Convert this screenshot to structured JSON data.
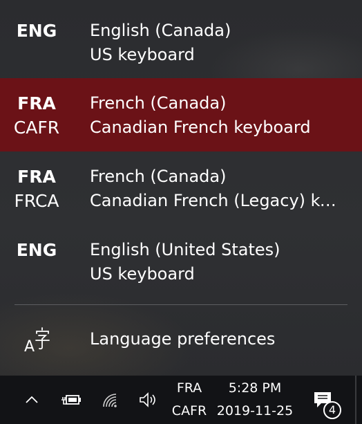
{
  "language_flyout": {
    "items": [
      {
        "code": "ENG",
        "sub_code": "",
        "language": "English (Canada)",
        "keyboard": "US keyboard",
        "selected": false
      },
      {
        "code": "FRA",
        "sub_code": "CAFR",
        "language": "French (Canada)",
        "keyboard": "Canadian French keyboard",
        "selected": true
      },
      {
        "code": "FRA",
        "sub_code": "FRCA",
        "language": "French (Canada)",
        "keyboard": "Canadian French (Legacy) ke...",
        "selected": false
      },
      {
        "code": "ENG",
        "sub_code": "",
        "language": "English (United States)",
        "keyboard": "US keyboard",
        "selected": false
      }
    ],
    "preferences_label": "Language preferences",
    "preferences_icon": "language-icon",
    "selected_color": "#6b1217"
  },
  "taskbar": {
    "icons": [
      "chevron-up-icon",
      "battery-icon",
      "wifi-icon",
      "volume-icon"
    ],
    "input_indicator": {
      "code": "FRA",
      "sub_code": "CAFR"
    },
    "clock": {
      "time": "5:28 PM",
      "date": "2019-11-25"
    },
    "notifications": {
      "icon": "action-center-icon",
      "count": "4"
    },
    "background_color": "#121316"
  }
}
